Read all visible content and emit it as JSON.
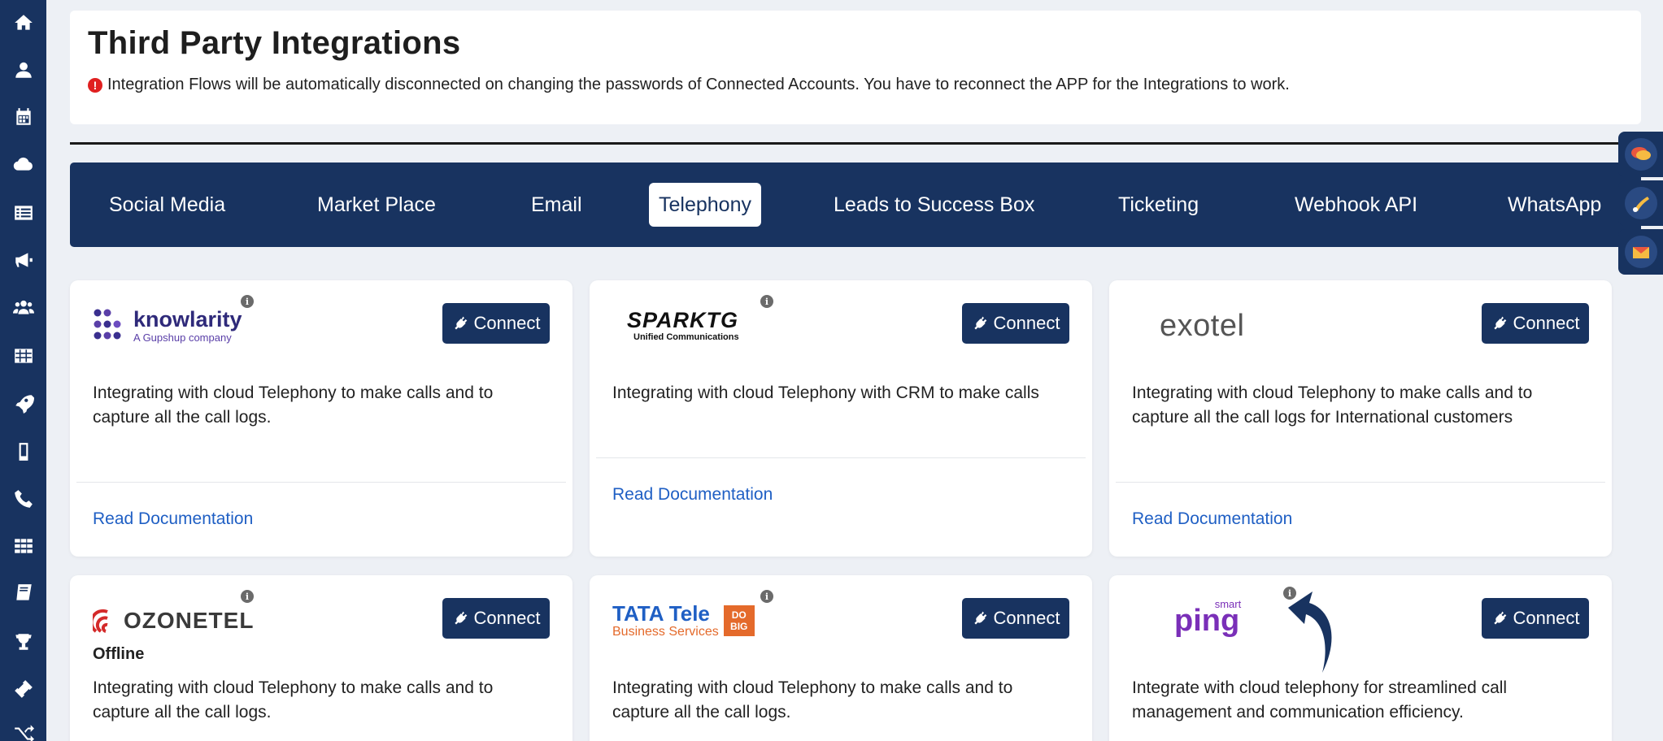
{
  "sidebar": {
    "icons": [
      "home-icon",
      "user-icon",
      "calendar-icon",
      "cloud-icon",
      "list-icon",
      "megaphone-icon",
      "users-icon",
      "table-icon",
      "rocket-icon",
      "mobile-icon",
      "phone-icon",
      "grid-icon",
      "book-icon",
      "trophy-icon",
      "ticket-icon",
      "shuffle-icon"
    ]
  },
  "header": {
    "title": "Third Party Integrations",
    "notice": "Integration Flows will be automatically disconnected on changing the passwords of Connected Accounts. You have to reconnect the APP for the Integrations to work."
  },
  "tabs": [
    {
      "label": "Social Media",
      "active": false
    },
    {
      "label": "Market Place",
      "active": false
    },
    {
      "label": "Email",
      "active": false
    },
    {
      "label": "Telephony",
      "active": true
    },
    {
      "label": "Leads to Success Box",
      "active": false
    },
    {
      "label": "Ticketing",
      "active": false
    },
    {
      "label": "Webhook API",
      "active": false
    },
    {
      "label": "WhatsApp",
      "active": false
    }
  ],
  "floating_widgets": [
    "chat-icon",
    "phone-call-icon",
    "mail-icon"
  ],
  "cards": [
    {
      "logo_text": "knowlarity",
      "logo_subtext": "A Gupshup company",
      "connect_label": "Connect",
      "description": "Integrating with cloud Telephony to make calls and to capture all the call logs.",
      "doc_link": "Read Documentation"
    },
    {
      "logo_text": "SPARKTG",
      "logo_subtext": "Unified Communications",
      "connect_label": "Connect",
      "description": "Integrating with cloud Telephony with CRM to make calls",
      "doc_link": "Read Documentation"
    },
    {
      "logo_text": "exotel",
      "connect_label": "Connect",
      "description": "Integrating with cloud Telephony to make calls and to capture all the call logs for International customers",
      "doc_link": "Read Documentation"
    },
    {
      "logo_text": "OZONETEL",
      "status": "Offline",
      "connect_label": "Connect",
      "description": "Integrating with cloud Telephony to make calls and to capture all the call logs."
    },
    {
      "logo_text": "TATA Tele",
      "logo_subtext": "Business Services",
      "logo_badge": "DO BIG",
      "connect_label": "Connect",
      "description": "Integrating with cloud Telephony to make calls and to capture all the call logs."
    },
    {
      "logo_text": "ping",
      "logo_superscript": "smart",
      "connect_label": "Connect",
      "description": "Integrate with cloud telephony for streamlined call management and communication efficiency."
    }
  ],
  "colors": {
    "navy": "#183360",
    "link": "#1f5fc4",
    "warning": "#e02020",
    "background": "#edf0f5"
  }
}
